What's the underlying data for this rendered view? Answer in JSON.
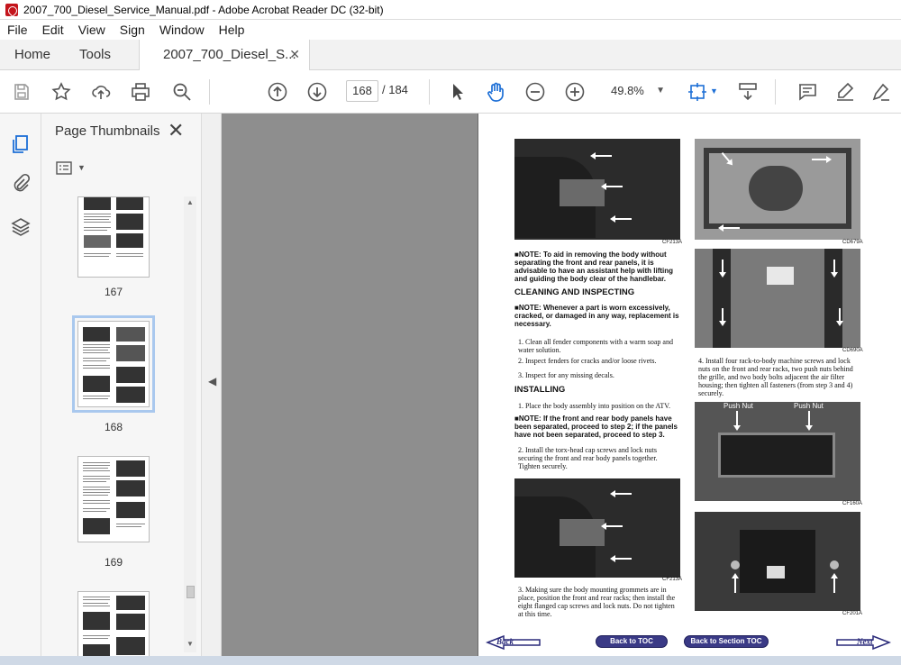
{
  "window": {
    "title": "2007_700_Diesel_Service_Manual.pdf - Adobe Acrobat Reader DC (32-bit)"
  },
  "menu": [
    "File",
    "Edit",
    "View",
    "Sign",
    "Window",
    "Help"
  ],
  "tabs": {
    "home": "Home",
    "tools": "Tools",
    "document": "2007_700_Diesel_S...",
    "close": "✕"
  },
  "toolbar": {
    "current_page": "168",
    "total_pages": "/ 184",
    "zoom": "49.8%"
  },
  "thumbnails": {
    "title": "Page Thumbnails",
    "close": "✕",
    "items": [
      {
        "label": "167",
        "selected": false
      },
      {
        "label": "168",
        "selected": true
      },
      {
        "label": "169",
        "selected": false
      }
    ]
  },
  "page": {
    "image_codes": [
      "CF213A",
      "CD679A",
      "CD690A",
      "CF160A",
      "CF213A",
      "CF201A"
    ],
    "push_nut_left": "Push Nut",
    "push_nut_right": "Push Nut",
    "note1": "■NOTE: To aid in removing the body without separating the front and rear panels, it is advisable to have an assistant help with lifting and guiding the body clear of the handlebar.",
    "heading_cleaning": "CLEANING AND INSPECTING",
    "note2": "■NOTE: Whenever a part is worn excessively, cracked, or damaged in any way, replacement is necessary.",
    "clean_steps": [
      "1. Clean all fender components with a warm soap and water solution.",
      "2. Inspect fenders for cracks and/or loose rivets.",
      "3. Inspect for any missing decals."
    ],
    "heading_installing": "INSTALLING",
    "install_step1": "1. Place the body assembly into position on the ATV.",
    "note3": "■NOTE: If the front and rear body panels have been separated, proceed to step 2; if the panels have not been separated, proceed to step 3.",
    "install_step2": "2. Install the torx-head cap screws and lock nuts securing the front and rear body panels together. Tighten securely.",
    "install_step3": "3. Making sure the body mounting grommets are in place, position the front and rear racks; then install the eight flanged cap screws and lock nuts. Do not tighten at this time.",
    "install_step4": "4. Install four rack-to-body machine screws and lock nuts on the front and rear racks, two push nuts behind the grille, and two body bolts adjacent the air filter housing; then tighten all fasteners (from step 3 and 4) securely.",
    "nav": {
      "back": "Back",
      "toc": "Back to TOC",
      "section_toc": "Back to Section TOC",
      "next": "Next"
    }
  }
}
